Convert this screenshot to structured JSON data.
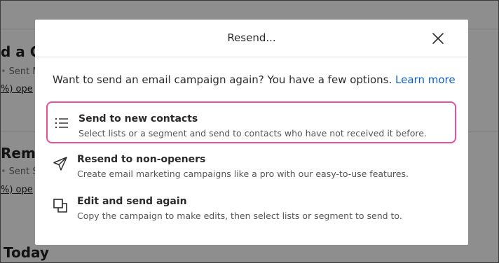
{
  "background": {
    "cards": [
      {
        "title": "d a C",
        "sent": "Sent M",
        "link": "%) ope"
      },
      {
        "title": "Remi",
        "sent": "Sent S",
        "link": "%) ope"
      },
      {
        "title": "Today"
      }
    ]
  },
  "modal": {
    "title": "Resend...",
    "intro_text": "Want to send an email campaign again? You have a few options.",
    "learn_more": "Learn more",
    "options": [
      {
        "title": "Send to new contacts",
        "description": "Select lists or a segment and send to contacts who have not received it before.",
        "icon": "list-icon",
        "highlighted": true
      },
      {
        "title": "Resend to non-openers",
        "description": "Create email marketing campaigns like a pro with our easy-to-use features.",
        "icon": "send-icon",
        "highlighted": false
      },
      {
        "title": "Edit and send again",
        "description": "Copy the campaign to make edits, then select lists or segment to send to.",
        "icon": "copy-icon",
        "highlighted": false
      }
    ]
  },
  "colors": {
    "highlight_border": "#ea4f99",
    "link": "#0b5ec2",
    "overlay": "rgba(0,0,0,0.42)"
  }
}
